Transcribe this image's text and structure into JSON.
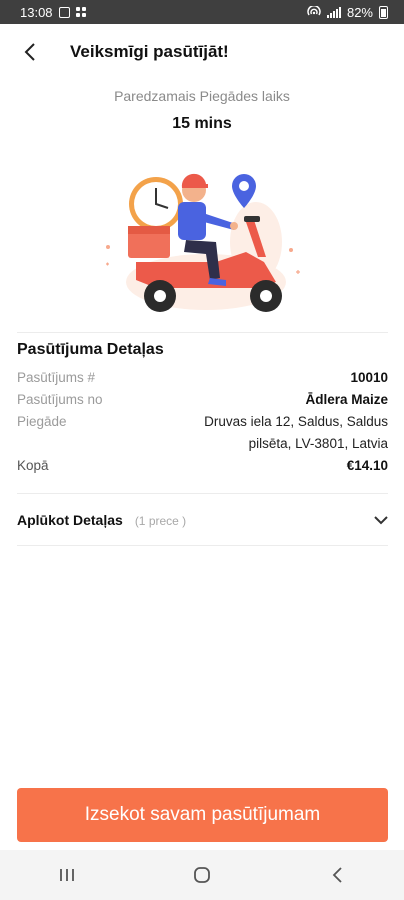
{
  "status_bar": {
    "time": "13:08",
    "battery": "82%"
  },
  "header": {
    "title": "Veiksmīgi pasūtījāt!"
  },
  "eta": {
    "label": "Paredzamais Piegādes laiks",
    "value": "15 mins"
  },
  "details": {
    "title": "Pasūtījuma Detaļas",
    "order_number_label": "Pasūtījums #",
    "order_number_value": "10010",
    "order_from_label": "Pasūtījums no",
    "order_from_value": "Ādlera Maize",
    "delivery_label": "Piegāde",
    "delivery_line1": "Druvas iela 12, Saldus, Saldus",
    "delivery_line2": "pilsēta, LV-3801, Latvia",
    "total_label": "Kopā",
    "total_value": "€14.10"
  },
  "expand": {
    "label": "Aplūkot Detaļas",
    "count": "(1 prece )"
  },
  "cta": {
    "label": "Izsekot savam pasūtījumam"
  },
  "colors": {
    "accent": "#f7734a",
    "status_bar": "#3f3f3f"
  },
  "icons": [
    "back-arrow-icon",
    "chevron-down-icon",
    "image-icon",
    "apps-grid-icon",
    "hotspot-icon",
    "signal-icon",
    "battery-icon",
    "recent-apps-icon",
    "home-icon",
    "nav-back-icon"
  ]
}
